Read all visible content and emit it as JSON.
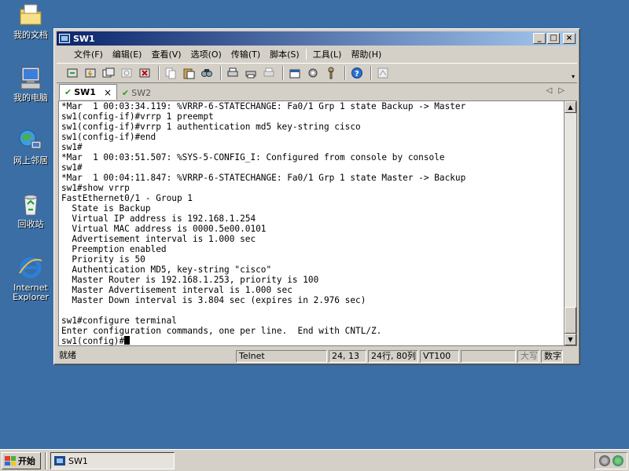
{
  "desktop": {
    "icons": [
      {
        "label": "我的文档"
      },
      {
        "label": "我的电脑"
      },
      {
        "label": "网上邻居"
      },
      {
        "label": "回收站"
      },
      {
        "label": "Internet\nExplorer"
      }
    ]
  },
  "window": {
    "title": "SW1",
    "buttons": {
      "minimize": "_",
      "maximize": "□",
      "close": "×"
    },
    "menu": [
      "文件(F)",
      "编辑(E)",
      "查看(V)",
      "选项(O)",
      "传输(T)",
      "脚本(S)",
      "工具(L)",
      "帮助(H)"
    ],
    "tabs": [
      {
        "label": "SW1",
        "active": true,
        "close": "×"
      },
      {
        "label": "SW2",
        "active": false
      }
    ],
    "tab_arrows": "◁▷"
  },
  "terminal": {
    "lines": [
      "*Mar  1 00:03:34.119: %VRRP-6-STATECHANGE: Fa0/1 Grp 1 state Backup -> Master",
      "sw1(config-if)#vrrp 1 preempt",
      "sw1(config-if)#vrrp 1 authentication md5 key-string cisco",
      "sw1(config-if)#end",
      "sw1#",
      "*Mar  1 00:03:51.507: %SYS-5-CONFIG_I: Configured from console by console",
      "sw1#",
      "*Mar  1 00:04:11.847: %VRRP-6-STATECHANGE: Fa0/1 Grp 1 state Master -> Backup",
      "sw1#show vrrp",
      "FastEthernet0/1 - Group 1",
      "  State is Backup",
      "  Virtual IP address is 192.168.1.254",
      "  Virtual MAC address is 0000.5e00.0101",
      "  Advertisement interval is 1.000 sec",
      "  Preemption enabled",
      "  Priority is 50",
      "  Authentication MD5, key-string \"cisco\"",
      "  Master Router is 192.168.1.253, priority is 100",
      "  Master Advertisement interval is 1.000 sec",
      "  Master Down interval is 3.804 sec (expires in 2.976 sec)",
      "",
      "sw1#configure terminal",
      "Enter configuration commands, one per line.  End with CNTL/Z."
    ],
    "prompt": "sw1(config)#"
  },
  "status": {
    "ready": "就绪",
    "protocol": "Telnet",
    "position": "24, 13",
    "size": "24行, 80列",
    "emulation": "VT100",
    "caps": "大写",
    "num": "数字"
  },
  "taskbar": {
    "start": "开始",
    "task": "SW1"
  }
}
